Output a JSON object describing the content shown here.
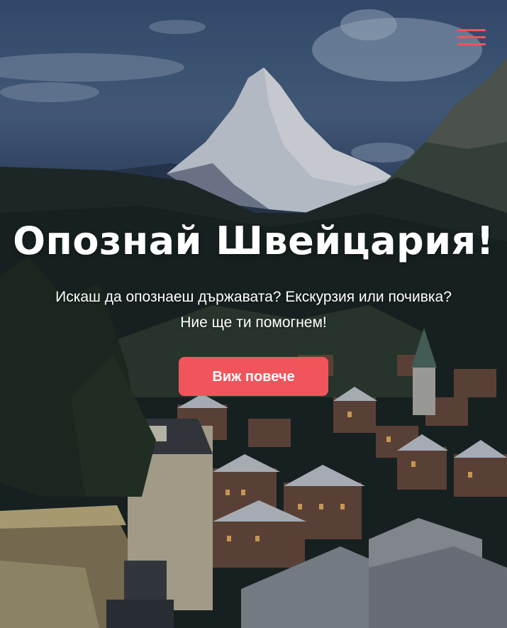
{
  "hero": {
    "title": "Опознай Швейцария!",
    "subtitle": "Искаш да опознаеш държавата? Екскурзия или почивка? Ние ще ти помогнем!",
    "cta_label": "Виж повече",
    "background": "matterhorn-zermatt-photo"
  },
  "nav": {
    "menu_icon": "hamburger-menu-icon"
  },
  "colors": {
    "accent": "#f2545b",
    "text": "#ffffff"
  }
}
